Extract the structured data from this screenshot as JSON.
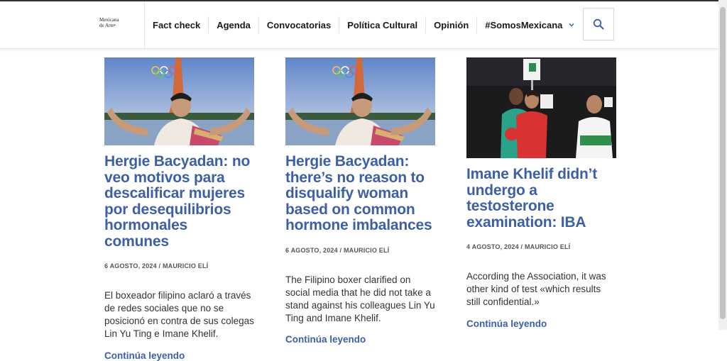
{
  "site": {
    "logo_line1": "Mexicana",
    "logo_line2": "de Arte"
  },
  "nav": {
    "items": [
      {
        "label": "Fact check"
      },
      {
        "label": "Agenda"
      },
      {
        "label": "Convocatorias"
      },
      {
        "label": "Política Cultural"
      },
      {
        "label": "Opinión"
      },
      {
        "label": "#SomosMexicana"
      }
    ]
  },
  "articles": [
    {
      "title": "Hergie Bacyadan: no veo motivos para descalificar mujeres por desequilibrios hormonales comunes",
      "date": "6 AGOSTO, 2024",
      "separator": "/",
      "author": "MAURICIO ELÍ",
      "excerpt": "El boxeador filipino aclaró a través de redes sociales que no se posicionó en contra de sus colegas Lin Yu Ting e Imane Khelif.",
      "more": "Continúa leyendo"
    },
    {
      "title": "Hergie Bacyadan: there’s no reason to disqualify woman based on common hormone imbalances",
      "date": "6 AGOSTO, 2024",
      "separator": "/",
      "author": "MAURICIO ELÍ",
      "excerpt": "The Filipino boxer clarified on social media that he did not take a stand against his colleagues Lin Yu Ting and Imane Khelif.",
      "more": "Continúa leyendo"
    },
    {
      "title": "Imane Khelif didn’t undergo a testosterone examination: IBA",
      "date": "4 AGOSTO, 2024",
      "separator": "/",
      "author": "MAURICIO ELÍ",
      "excerpt": "According the Association, it was other kind of test «which results still confidential.»",
      "more": "Continúa leyendo"
    }
  ],
  "colors": {
    "accent": "#3c5fa8",
    "text": "#333333"
  },
  "icons": {
    "search": "search-icon",
    "dropdown": "chevron-down-icon"
  }
}
